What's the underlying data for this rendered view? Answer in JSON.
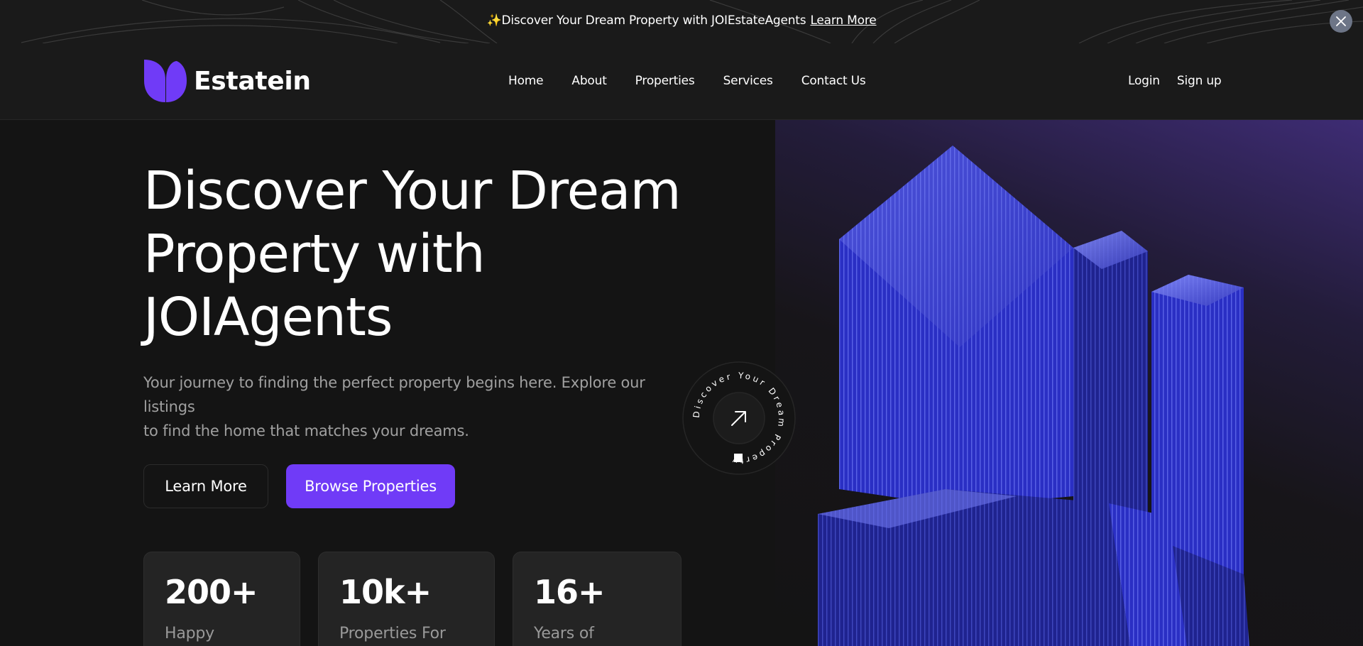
{
  "announcement": {
    "sparkle": "✨",
    "text": "Discover Your Dream Property with JOIEstateAgents",
    "link": "Learn More"
  },
  "brand": {
    "name": "Estatein",
    "accent": "#703bf7"
  },
  "nav": {
    "items": [
      "Home",
      "About",
      "Properties",
      "Services",
      "Contact Us"
    ]
  },
  "auth": {
    "login": "Login",
    "signup": "Sign up"
  },
  "hero": {
    "title_line1": "Discover Your Dream",
    "title_line2": "Property with",
    "title_line3": "JOIAgents",
    "subtitle_line1": "Your journey to finding the perfect property begins here. Explore our listings",
    "subtitle_line2": "to find the home that matches your dreams.",
    "learn_more": "Learn More",
    "browse": "Browse Properties",
    "badge_text": "Discover Your Dream Property"
  },
  "stats": [
    {
      "value": "200+",
      "label": "Happy"
    },
    {
      "value": "10k+",
      "label": "Properties For"
    },
    {
      "value": "16+",
      "label": "Years of"
    }
  ],
  "icons": {
    "close": "close-icon",
    "arrow": "arrow-up-right-icon",
    "logo": "brand-logo-icon"
  }
}
